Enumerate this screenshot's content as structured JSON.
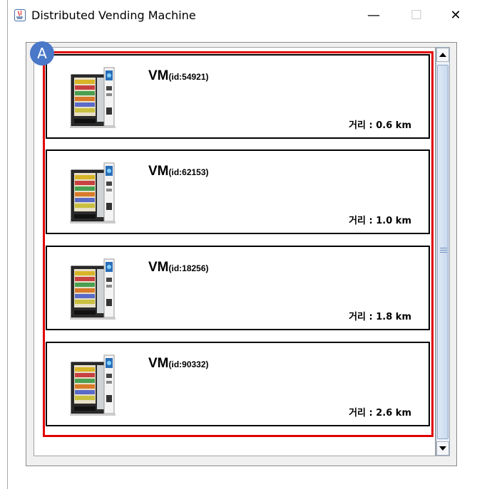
{
  "window": {
    "title": "Distributed Vending Machine",
    "controls": {
      "minimize": "—",
      "maximize": "☐",
      "close": "✕"
    }
  },
  "annotation": {
    "marker": "A",
    "highlight_color": "#e00000",
    "marker_color": "#4a78c8"
  },
  "icons": {
    "app": "java-app-icon",
    "machine": "vending-machine-icon",
    "scroll_up": "triangle-up-icon",
    "scroll_down": "triangle-down-icon"
  },
  "machines": [
    {
      "prefix": "VM",
      "id_text": "(id:54921)",
      "distance": "거리 : 0.6 km"
    },
    {
      "prefix": "VM",
      "id_text": "(id:62153)",
      "distance": "거리 : 1.0 km"
    },
    {
      "prefix": "VM",
      "id_text": "(id:18256)",
      "distance": "거리 : 1.8 km"
    },
    {
      "prefix": "VM",
      "id_text": "(id:90332)",
      "distance": "거리 : 2.6 km"
    }
  ]
}
